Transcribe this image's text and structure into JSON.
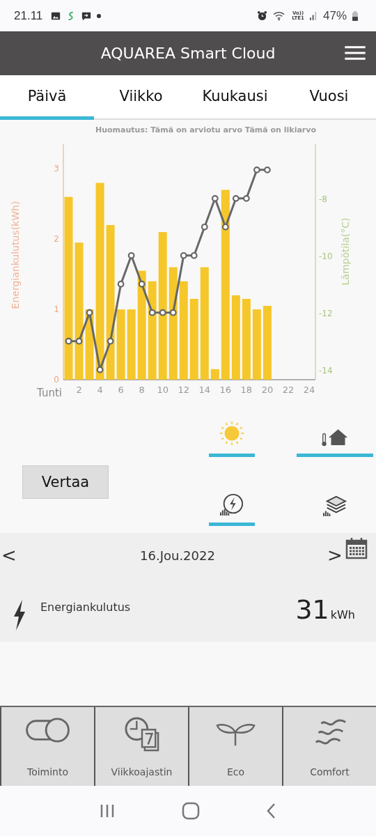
{
  "status_bar": {
    "time": "21.11",
    "battery": "47%",
    "network": "Vo))\nLTE1"
  },
  "header": {
    "title": "AQUAREA Smart Cloud"
  },
  "tabs": [
    {
      "label": "Päivä",
      "selected": true
    },
    {
      "label": "Viikko",
      "selected": false
    },
    {
      "label": "Kuukausi",
      "selected": false
    },
    {
      "label": "Vuosi",
      "selected": false
    }
  ],
  "chart": {
    "note": "Huomautus: Tämä on arviotu arvo Tämä on likiarvo",
    "energy": {
      "chart_data": {
        "type": "bar",
        "xlabel": "Tunti",
        "ylabel": "Energiankulutus(kWh)",
        "x": [
          1,
          2,
          3,
          4,
          5,
          6,
          7,
          8,
          9,
          10,
          11,
          12,
          13,
          14,
          15,
          16,
          17,
          18,
          19,
          20
        ],
        "xlim": [
          0.5,
          24.6
        ],
        "xticks": [
          2,
          4,
          6,
          8,
          10,
          12,
          14,
          16,
          18,
          20,
          22,
          24
        ],
        "ylim": [
          0,
          3.35
        ],
        "yticks": [
          0,
          1,
          2,
          3
        ],
        "series": [
          {
            "color": "#f5c72a",
            "values": [
              2.6,
              1.95,
              1.0,
              2.8,
              2.2,
              1.0,
              1.0,
              1.55,
              1.4,
              2.1,
              1.6,
              1.4,
              1.15,
              1.6,
              0.15,
              2.7,
              1.2,
              1.15,
              1.0,
              1.05
            ]
          }
        ]
      }
    },
    "temperature": {
      "chart_data": {
        "type": "line",
        "ylabel": "Lämpötila(°C)",
        "x": [
          1,
          2,
          3,
          4,
          5,
          6,
          7,
          8,
          9,
          10,
          11,
          12,
          13,
          14,
          15,
          16,
          17,
          18,
          19,
          20
        ],
        "xlim": [
          0.5,
          24.6
        ],
        "ylim": [
          -14.35,
          -6.1
        ],
        "yticks": [
          -14,
          -12,
          -10,
          -8
        ],
        "series": [
          {
            "color": "#676767",
            "marker": true,
            "values": [
              -13,
              -13,
              -12,
              -14,
              -13,
              -11,
              -10,
              -11,
              -12,
              -12,
              -12,
              -10,
              -10,
              -9,
              -8,
              -9,
              -8,
              -8,
              -7,
              -7
            ]
          }
        ]
      }
    }
  },
  "view_options": [
    {
      "kind": "sun",
      "selected": true
    },
    {
      "kind": "house",
      "selected": true
    },
    {
      "kind": "energy",
      "selected": true
    },
    {
      "kind": "layers",
      "selected": false
    }
  ],
  "compare_button": "Vertaa",
  "date_nav": {
    "prev": "<",
    "date": "16.Jou.2022",
    "next": ">"
  },
  "summary": {
    "label": "Energiankulutus",
    "value": "31",
    "unit": "kWh"
  },
  "bottom_nav": [
    {
      "kind": "toggle",
      "label": "Toiminto"
    },
    {
      "kind": "schedule",
      "label": "Viikkoajastin"
    },
    {
      "kind": "eco",
      "label": "Eco"
    },
    {
      "kind": "comfort",
      "label": "Comfort"
    }
  ]
}
